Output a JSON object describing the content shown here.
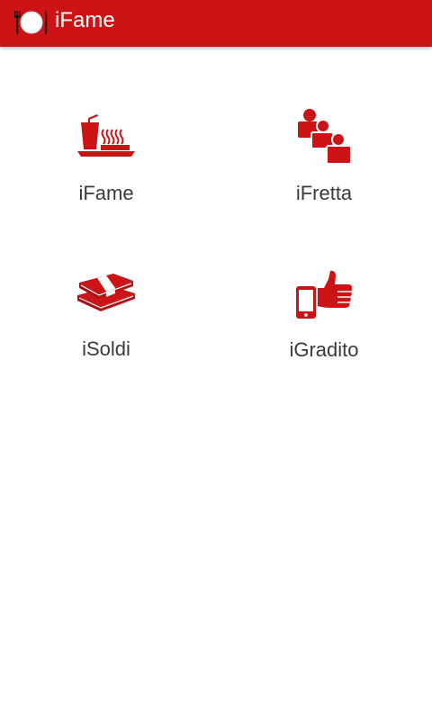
{
  "action_bar": {
    "title": "iFame",
    "app_icon": "plate-fork-knife-icon",
    "background": "#cc1417"
  },
  "menu": {
    "accent": "#cc1417",
    "items": [
      {
        "label": "iFame",
        "icon": "food-tray-icon"
      },
      {
        "label": "iFretta",
        "icon": "people-group-icon"
      },
      {
        "label": "iSoldi",
        "icon": "money-bundle-icon"
      },
      {
        "label": "iGradito",
        "icon": "phone-thumbs-up-icon"
      }
    ]
  }
}
